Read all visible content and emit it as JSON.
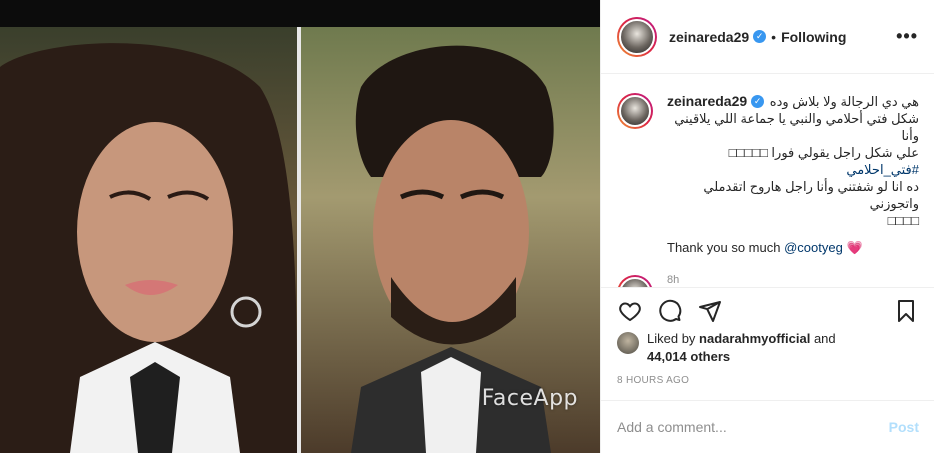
{
  "post": {
    "watermark": "FaceApp"
  },
  "header": {
    "username": "zeinareda29",
    "separator": "•",
    "follow_status": "Following",
    "more_label": "•••"
  },
  "caption": {
    "username": "zeinareda29",
    "line1": "هي دي الرجالة ولا بلاش وده",
    "line2": "شكل فتي أحلامي والنبي يا جماعة اللي يلاقيني وأنا",
    "line3": "علي شكل راجل يقولي فورا □□□□□",
    "hashtag": "#فتي_احلامي",
    "line4": "ده انا لو شفتني وأنا راجل هاروح اتقدملي واتجوزني",
    "line5": "□□□□",
    "thanks_text": "Thank you so much",
    "thanks_mention": "@cootyeg",
    "thanks_emoji": "💗",
    "time": "8h"
  },
  "actions": {
    "like_icon": "heart-icon",
    "comment_icon": "comment-icon",
    "share_icon": "share-icon",
    "save_icon": "bookmark-icon"
  },
  "likes": {
    "prefix": "Liked by",
    "user": "nadarahmyofficial",
    "and": "and",
    "count": "44,014 others"
  },
  "post_time": "8 HOURS AGO",
  "comment_box": {
    "placeholder": "Add a comment...",
    "post_label": "Post"
  }
}
